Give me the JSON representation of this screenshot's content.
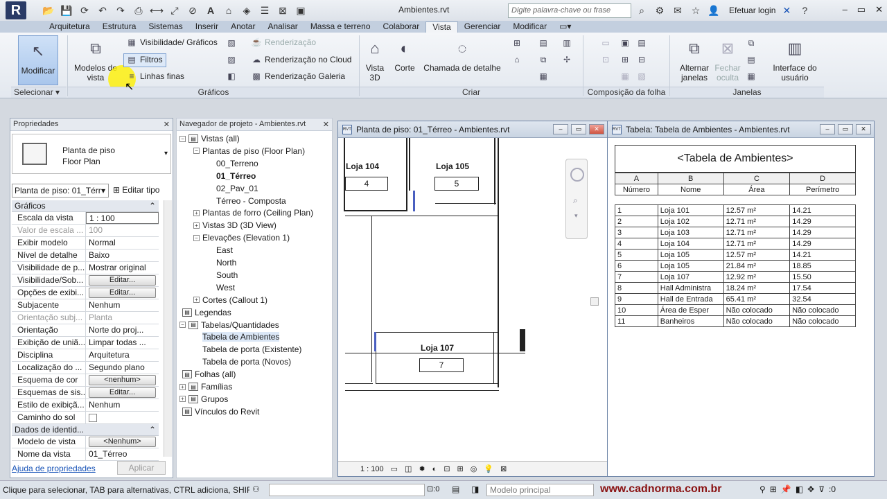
{
  "titlebar": {
    "doc_title": "Ambientes.rvt",
    "search_placeholder": "Digite palavra-chave ou frase",
    "login": "Efetuar login",
    "app_letter": "R"
  },
  "tabs": [
    "Arquitetura",
    "Estrutura",
    "Sistemas",
    "Inserir",
    "Anotar",
    "Analisar",
    "Massa e terreno",
    "Colaborar",
    "Vista",
    "Gerenciar",
    "Modificar"
  ],
  "ribbon": {
    "modificar": "Modificar",
    "selecionar": "Selecionar",
    "modelos_vista_1": "Modelos de",
    "modelos_vista_2": "vista",
    "visibilidade": "Visibilidade/ Gráficos",
    "filtros": "Filtros",
    "linhas_finas": "Linhas  finas",
    "renderizacao": "Renderização",
    "render_cloud": "Renderização  no Cloud",
    "render_galeria": "Renderização  Galeria",
    "graficos_group": "Gráficos",
    "vista3d_1": "Vista",
    "vista3d_2": "3D",
    "corte": "Corte",
    "chamada": "Chamada de detalhe",
    "criar_group": "Criar",
    "composicao_group": "Composição da folha",
    "alternar_1": "Alternar",
    "alternar_2": "janelas",
    "fechar_1": "Fechar",
    "fechar_2": "oculta",
    "interface_1": "Interface do",
    "interface_2": "usuário",
    "janelas_group": "Janelas"
  },
  "properties": {
    "title": "Propriedades",
    "type_line1": "Planta de piso",
    "type_line2": "Floor Plan",
    "selector": "Planta de piso: 01_Térr",
    "edit_type": "Editar tipo",
    "cat_graficos": "Gráficos",
    "rows": [
      {
        "k": "Escala da vista",
        "v": "1 : 100",
        "kind": "input"
      },
      {
        "k": "Valor de escala ...",
        "v": "100",
        "kind": "gray"
      },
      {
        "k": "Exibir modelo",
        "v": "Normal",
        "kind": "text"
      },
      {
        "k": "Nível de detalhe",
        "v": "Baixo",
        "kind": "text"
      },
      {
        "k": "Visibilidade de p...",
        "v": "Mostrar original",
        "kind": "text"
      },
      {
        "k": "Visibilidade/Sob...",
        "v": "Editar...",
        "kind": "button"
      },
      {
        "k": "Opções de exibi...",
        "v": "Editar...",
        "kind": "button"
      },
      {
        "k": "Subjacente",
        "v": "Nenhum",
        "kind": "text"
      },
      {
        "k": "Orientação subj...",
        "v": "Planta",
        "kind": "gray"
      },
      {
        "k": "Orientação",
        "v": "Norte do proj...",
        "kind": "text"
      },
      {
        "k": "Exibição de uniã...",
        "v": "Limpar todas ...",
        "kind": "text"
      },
      {
        "k": "Disciplina",
        "v": "Arquitetura",
        "kind": "text"
      },
      {
        "k": "Localização do ...",
        "v": "Segundo plano",
        "kind": "text"
      },
      {
        "k": "Esquema de cor",
        "v": "<nenhum>",
        "kind": "button"
      },
      {
        "k": "Esquemas de sis...",
        "v": "Editar...",
        "kind": "button"
      },
      {
        "k": "Estilo de exibiçã...",
        "v": "Nenhum",
        "kind": "text"
      },
      {
        "k": "Caminho do sol",
        "v": "",
        "kind": "check"
      }
    ],
    "cat_dados": "Dados de identid...",
    "rows2": [
      {
        "k": "Modelo de vista",
        "v": "<Nenhum>",
        "kind": "button"
      },
      {
        "k": "Nome da vista",
        "v": "01_Térreo",
        "kind": "text"
      }
    ],
    "help_link": "Ajuda de propriedades",
    "apply": "Aplicar"
  },
  "navigator": {
    "title": "Navegador de projeto - Ambientes.rvt",
    "items": [
      {
        "label": "Vistas (all)",
        "level": 0,
        "tw": "−",
        "icon": true
      },
      {
        "label": "Plantas de piso (Floor Plan)",
        "level": 1,
        "tw": "−"
      },
      {
        "label": "00_Terreno",
        "level": 2
      },
      {
        "label": "01_Térreo",
        "level": 2,
        "bold": true
      },
      {
        "label": "02_Pav_01",
        "level": 2
      },
      {
        "label": "Térreo - Composta",
        "level": 2
      },
      {
        "label": "Plantas de forro (Ceiling Plan)",
        "level": 1,
        "tw": "+"
      },
      {
        "label": "Vistas 3D (3D View)",
        "level": 1,
        "tw": "+"
      },
      {
        "label": "Elevações (Elevation 1)",
        "level": 1,
        "tw": "−"
      },
      {
        "label": "East",
        "level": 2
      },
      {
        "label": "North",
        "level": 2
      },
      {
        "label": "South",
        "level": 2
      },
      {
        "label": "West",
        "level": 2
      },
      {
        "label": "Cortes (Callout 1)",
        "level": 1,
        "tw": "+"
      },
      {
        "label": "Legendas",
        "level": 0,
        "icon": true
      },
      {
        "label": "Tabelas/Quantidades",
        "level": 0,
        "tw": "−",
        "icon": true
      },
      {
        "label": "Tabela de Ambientes",
        "level": 1,
        "sel": true
      },
      {
        "label": "Tabela de porta (Existente)",
        "level": 1
      },
      {
        "label": "Tabela de porta (Novos)",
        "level": 1
      },
      {
        "label": "Folhas (all)",
        "level": 0,
        "icon": true
      },
      {
        "label": "Famílias",
        "level": 0,
        "tw": "+",
        "icon": true
      },
      {
        "label": "Grupos",
        "level": 0,
        "tw": "+",
        "icon": true
      },
      {
        "label": "Vínculos do Revit",
        "level": 0,
        "icon": true
      }
    ]
  },
  "planview": {
    "title": "Planta de piso: 01_Térreo - Ambientes.rvt",
    "rooms": [
      {
        "name": "Loja 104",
        "num": "4"
      },
      {
        "name": "Loja 105",
        "num": "5"
      },
      {
        "name": "Loja 107",
        "num": "7"
      }
    ],
    "scale": "1 : 100"
  },
  "schedule": {
    "window_title": "Tabela: Tabela de Ambientes - Ambientes.rvt",
    "title": "<Tabela de Ambientes>",
    "letters": [
      "A",
      "B",
      "C",
      "D"
    ],
    "headers": [
      "Número",
      "Nome",
      "Área",
      "Perímetro"
    ],
    "rows": [
      [
        "1",
        "Loja 101",
        "12.57 m²",
        "14.21"
      ],
      [
        "2",
        "Loja 102",
        "12.71 m²",
        "14.29"
      ],
      [
        "3",
        "Loja 103",
        "12.71 m²",
        "14.29"
      ],
      [
        "4",
        "Loja 104",
        "12.71 m²",
        "14.29"
      ],
      [
        "5",
        "Loja 105",
        "12.57 m²",
        "14.21"
      ],
      [
        "6",
        "Loja 105",
        "21.84 m²",
        "18.85"
      ],
      [
        "7",
        "Loja 107",
        "12.92 m²",
        "15.50"
      ],
      [
        "8",
        "Hall Administra",
        "18.24 m²",
        "17.54"
      ],
      [
        "9",
        "Hall de Entrada",
        "65.41 m²",
        "32.54"
      ],
      [
        "10",
        "Área de Esper",
        "Não colocado",
        "Não colocado"
      ],
      [
        "11",
        "Banheiros",
        "Não colocado",
        "Não colocado"
      ]
    ]
  },
  "statusbar": {
    "message": "Clique para selecionar, TAB para alternativas, CTRL adiciona, SHIF",
    "count": ":0",
    "model": "Modelo principal",
    "url": "www.cadnorma.com.br",
    "filter_count": ":0"
  }
}
